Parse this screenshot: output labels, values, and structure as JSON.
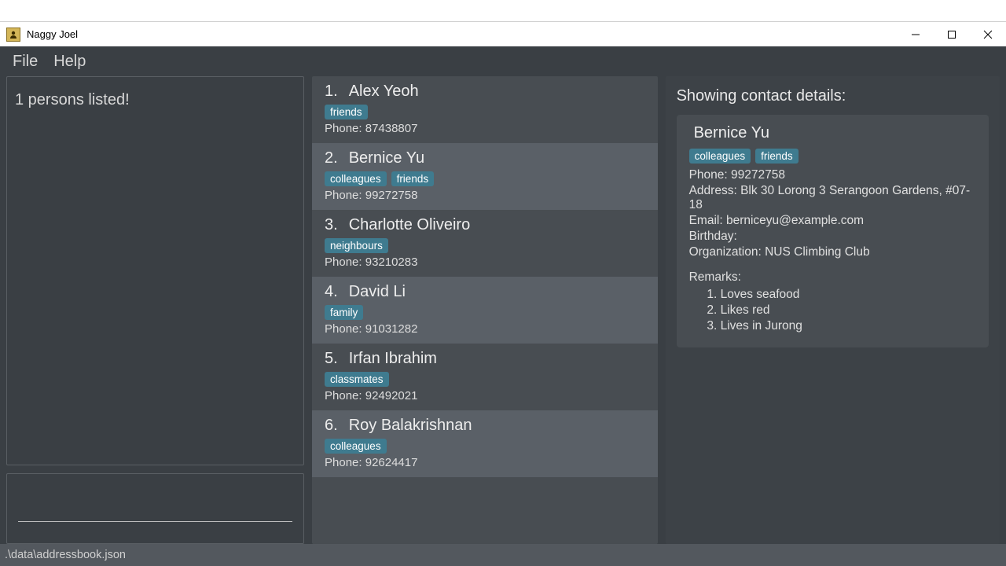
{
  "window": {
    "title": "Naggy Joel",
    "minimize_name": "minimize-icon",
    "maximize_name": "maximize-icon",
    "close_name": "close-icon"
  },
  "menu": {
    "file": "File",
    "help": "Help"
  },
  "status": {
    "text": "1 persons listed!"
  },
  "command_input": {
    "placeholder": "",
    "value": ""
  },
  "persons": [
    {
      "index": "1.",
      "name": "Alex Yeoh",
      "tags": [
        "friends"
      ],
      "phone": "Phone: 87438807"
    },
    {
      "index": "2.",
      "name": "Bernice Yu",
      "tags": [
        "colleagues",
        "friends"
      ],
      "phone": "Phone: 99272758"
    },
    {
      "index": "3.",
      "name": "Charlotte Oliveiro",
      "tags": [
        "neighbours"
      ],
      "phone": "Phone: 93210283"
    },
    {
      "index": "4.",
      "name": "David Li",
      "tags": [
        "family"
      ],
      "phone": "Phone: 91031282"
    },
    {
      "index": "5.",
      "name": "Irfan Ibrahim",
      "tags": [
        "classmates"
      ],
      "phone": "Phone: 92492021"
    },
    {
      "index": "6.",
      "name": "Roy Balakrishnan",
      "tags": [
        "colleagues"
      ],
      "phone": "Phone: 92624417"
    }
  ],
  "details": {
    "section_title": "Showing contact details:",
    "name": "Bernice Yu",
    "tags": [
      "colleagues",
      "friends"
    ],
    "phone": "Phone: 99272758",
    "address": "Address: Blk 30 Lorong 3 Serangoon Gardens, #07-18",
    "email": "Email: berniceyu@example.com",
    "birthday": "Birthday:",
    "organization": "Organization: NUS Climbing Club",
    "remarks_label": "Remarks:",
    "remarks": [
      "Loves seafood",
      "Likes red",
      "Lives in Jurong"
    ]
  },
  "footer": {
    "path": ".\\data\\addressbook.json"
  }
}
